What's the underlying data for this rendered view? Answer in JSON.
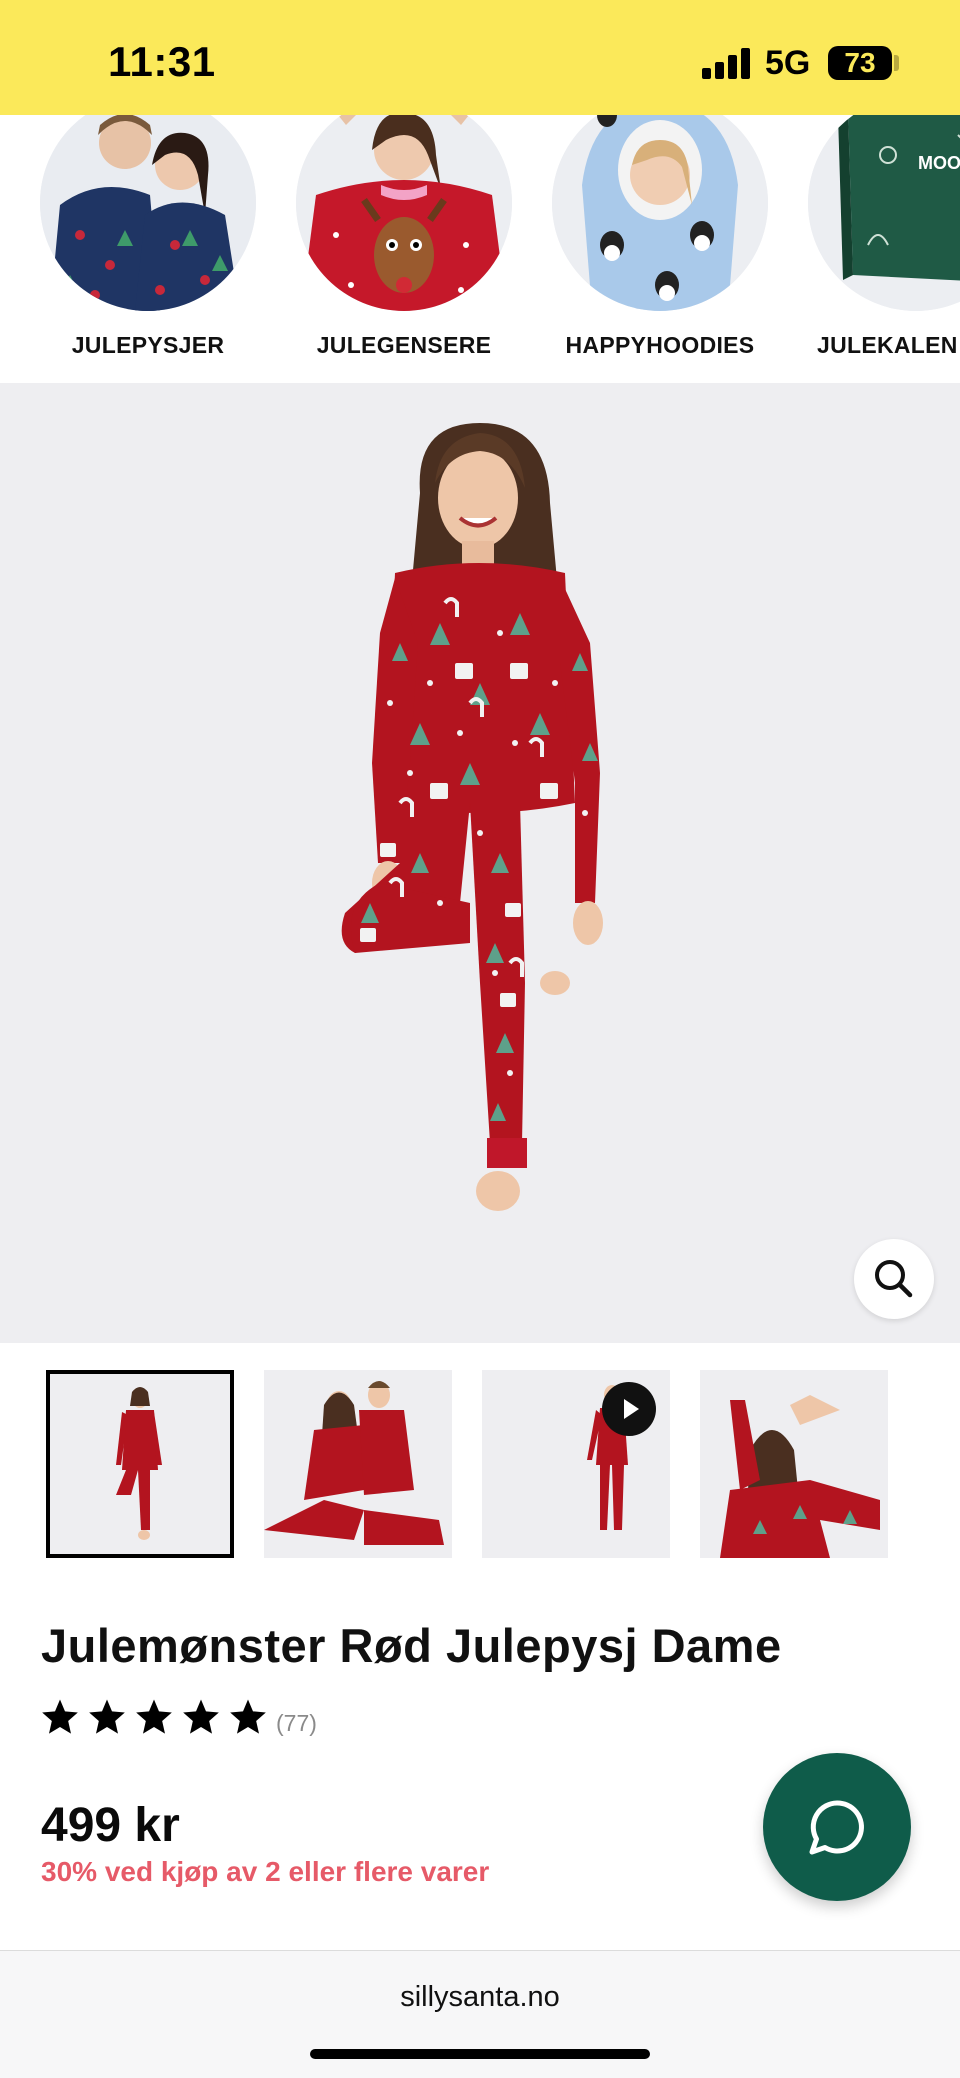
{
  "status_bar": {
    "time": "11:31",
    "network": "5G",
    "battery_level": "73",
    "background_color": "#fbe95a"
  },
  "categories": [
    {
      "label": "JULEPYSJER"
    },
    {
      "label": "JULEGENSERE"
    },
    {
      "label": "HAPPYHOODIES"
    },
    {
      "label": "JULEKALENDERE",
      "visible_label": "JULEKALEN",
      "image_text": "MOOMIN"
    }
  ],
  "product": {
    "title": "Julemønster Rød Julepysj Dame",
    "rating_stars": 5,
    "review_count": "(77)",
    "price": "499 kr",
    "promo": "30% ved kjøp av 2 eller flere varer",
    "thumbnails": [
      {
        "selected": true,
        "type": "image"
      },
      {
        "selected": false,
        "type": "image"
      },
      {
        "selected": false,
        "type": "video"
      },
      {
        "selected": false,
        "type": "image"
      }
    ]
  },
  "icons": {
    "zoom": "search-icon",
    "chat": "chat-bubble-icon",
    "play": "play-icon",
    "star": "star-icon"
  },
  "colors": {
    "accent_yellow": "#fbe95a",
    "promo_red": "#e65a68",
    "chat_green": "#0f5c4a",
    "pajama_red": "#b3141f"
  },
  "browser": {
    "url": "sillysanta.no"
  }
}
